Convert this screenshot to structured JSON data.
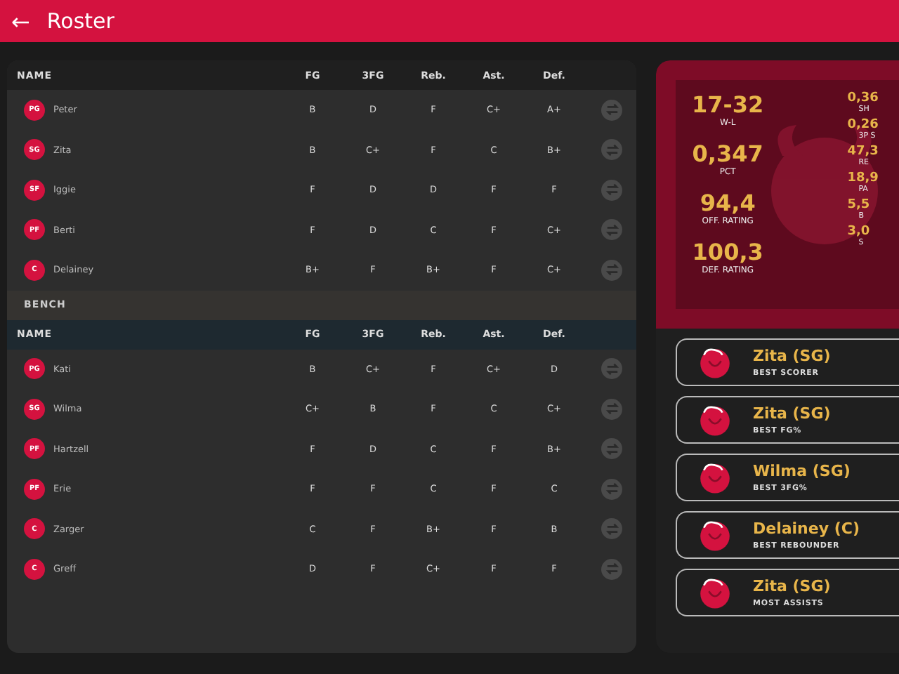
{
  "header": {
    "back": "←",
    "title": "Roster"
  },
  "columns": [
    "NAME",
    "FG",
    "3FG",
    "Reb.",
    "Ast.",
    "Def."
  ],
  "starters": [
    {
      "pos": "PG",
      "name": "Peter",
      "grades": [
        "B",
        "D",
        "F",
        "C+",
        "A+"
      ]
    },
    {
      "pos": "SG",
      "name": "Zita",
      "grades": [
        "B",
        "C+",
        "F",
        "C",
        "B+"
      ]
    },
    {
      "pos": "SF",
      "name": "Iggie",
      "grades": [
        "F",
        "D",
        "D",
        "F",
        "F"
      ]
    },
    {
      "pos": "PF",
      "name": "Berti",
      "grades": [
        "F",
        "D",
        "C",
        "F",
        "C+"
      ]
    },
    {
      "pos": "C",
      "name": "Delainey",
      "grades": [
        "B+",
        "F",
        "B+",
        "F",
        "C+"
      ]
    }
  ],
  "bench_label": "BENCH",
  "bench_columns": [
    "NAME",
    "FG",
    "3FG",
    "Reb.",
    "Ast.",
    "Def."
  ],
  "bench": [
    {
      "pos": "PG",
      "name": "Kati",
      "grades": [
        "B",
        "C+",
        "F",
        "C+",
        "D"
      ]
    },
    {
      "pos": "SG",
      "name": "Wilma",
      "grades": [
        "C+",
        "B",
        "F",
        "C",
        "C+"
      ]
    },
    {
      "pos": "PF",
      "name": "Hartzell",
      "grades": [
        "F",
        "D",
        "C",
        "F",
        "B+"
      ]
    },
    {
      "pos": "PF",
      "name": "Erie",
      "grades": [
        "F",
        "F",
        "C",
        "F",
        "C"
      ]
    },
    {
      "pos": "C",
      "name": "Zarger",
      "grades": [
        "C",
        "F",
        "B+",
        "F",
        "B"
      ]
    },
    {
      "pos": "C",
      "name": "Greff",
      "grades": [
        "D",
        "F",
        "C+",
        "F",
        "F"
      ]
    }
  ],
  "team_stats": [
    {
      "value": "17-32",
      "label": "W-L"
    },
    {
      "value": "0,347",
      "label": "PCT"
    },
    {
      "value": "94,4",
      "label": "OFF. RATING"
    },
    {
      "value": "100,3",
      "label": "DEF. RATING"
    }
  ],
  "team_stats_2": [
    {
      "value": "0,36",
      "label": "SH"
    },
    {
      "value": "0,26",
      "label": "3P S"
    },
    {
      "value": "47,3",
      "label": "RE"
    },
    {
      "value": "18,9",
      "label": "PA"
    },
    {
      "value": "5,5",
      "label": "B"
    },
    {
      "value": "3,0",
      "label": "S"
    }
  ],
  "awards": [
    {
      "player": "Zita (SG)",
      "title": "BEST SCORER"
    },
    {
      "player": "Zita (SG)",
      "title": "BEST FG%"
    },
    {
      "player": "Wilma (SG)",
      "title": "BEST 3FG%"
    },
    {
      "player": "Delainey (C)",
      "title": "BEST REBOUNDER"
    },
    {
      "player": "Zita (SG)",
      "title": "MOST ASSISTS"
    }
  ]
}
